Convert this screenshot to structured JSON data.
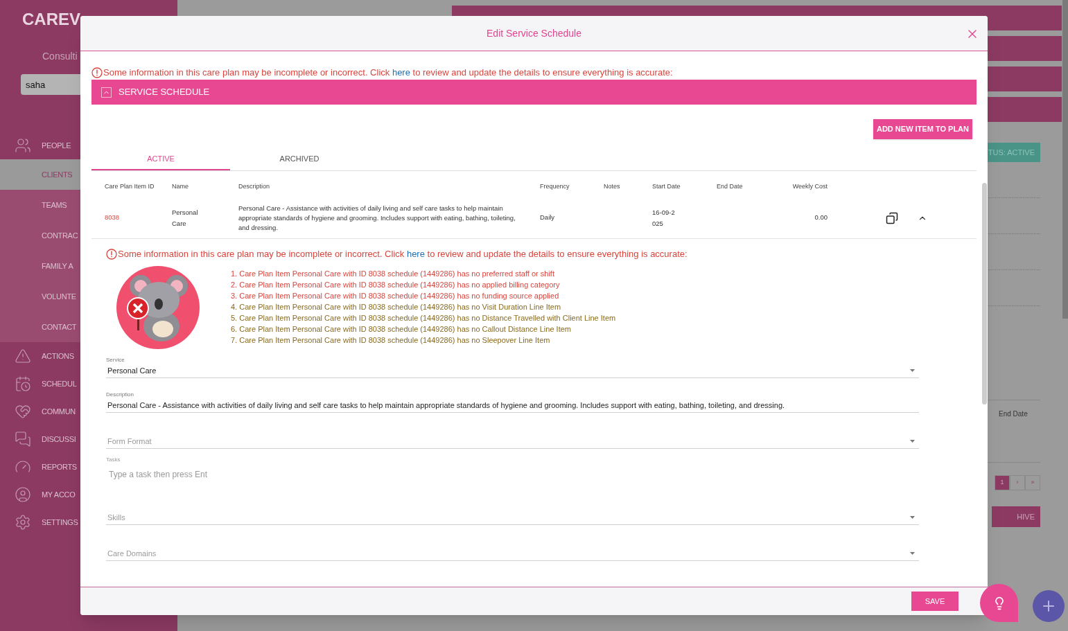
{
  "app": {
    "logo": "CAREV",
    "subtitle": "Consulti",
    "search": {
      "value": "saha"
    }
  },
  "sidebar": {
    "items": [
      {
        "label": "PEOPLE",
        "kind": "section",
        "selected": false
      },
      {
        "label": "CLIENTS",
        "kind": "sub",
        "selected": true
      },
      {
        "label": "TEAMS",
        "kind": "sub",
        "selected": false
      },
      {
        "label": "CONTRAC",
        "kind": "sub",
        "selected": false
      },
      {
        "label": "FAMILY A",
        "kind": "sub",
        "selected": false
      },
      {
        "label": "VOLUNTE",
        "kind": "sub",
        "selected": false
      },
      {
        "label": "CONTACT",
        "kind": "sub",
        "selected": false
      },
      {
        "label": "ACTIONS",
        "kind": "section",
        "selected": false
      },
      {
        "label": "SCHEDUL",
        "kind": "section",
        "selected": false
      },
      {
        "label": "COMMUN",
        "kind": "section",
        "selected": false
      },
      {
        "label": "DISCUSSI",
        "kind": "section",
        "selected": false
      },
      {
        "label": "REPORTS",
        "kind": "section",
        "selected": false
      },
      {
        "label": "MY ACCO",
        "kind": "section",
        "selected": false
      },
      {
        "label": "SETTINGS",
        "kind": "section",
        "selected": false
      }
    ]
  },
  "background": {
    "status_button": "TUS: ACTIVE",
    "column_header": "End Date",
    "pagination": [
      {
        "label": "1",
        "selected": true
      },
      {
        "label": "›",
        "selected": false
      },
      {
        "label": "»",
        "selected": false
      }
    ],
    "archive_button": "HIVE"
  },
  "modal": {
    "title": "Edit Service Schedule",
    "warning": {
      "before": "Some information in this care plan may be incomplete or incorrect. Click ",
      "link": "here",
      "after": " to review and update the details to ensure everything is accurate:"
    },
    "section": {
      "title": "SERVICE SCHEDULE",
      "expanded": true
    },
    "add_button": "ADD NEW ITEM TO PLAN",
    "tabs": [
      {
        "label": "ACTIVE",
        "selected": true
      },
      {
        "label": "ARCHIVED",
        "selected": false
      }
    ],
    "table": {
      "columns": [
        "Care Plan Item ID",
        "Name",
        "Description",
        "Frequency",
        "Notes",
        "Start Date",
        "End Date",
        "Weekly Cost"
      ],
      "rows": [
        {
          "id": "8038",
          "name": "Personal Care",
          "description": "Personal Care - Assistance with activities of daily living and self care tasks to help maintain appropriate standards of hygiene and grooming. Includes support with eating, bathing, toileting, and dressing.",
          "frequency": "Daily",
          "start_date": "16-09-2025",
          "weekly_cost": "0.00",
          "expanded": true
        }
      ]
    },
    "row_warning": {
      "before": "Some information in this care plan may be incomplete or incorrect. Click ",
      "link": "here",
      "after": " to review and update the details to ensure everything is accurate:"
    },
    "issues": [
      {
        "text": "1. Care Plan Item Personal Care with ID 8038 schedule (1449286) has no preferred staff or shift",
        "color": "#d9443c"
      },
      {
        "text": "2. Care Plan Item Personal Care with ID 8038 schedule (1449286) has no applied billing category",
        "color": "#d9443c"
      },
      {
        "text": "3. Care Plan Item Personal Care with ID 8038 schedule (1449286) has no funding source applied",
        "color": "#d9443c"
      },
      {
        "text": "4. Care Plan Item Personal Care with ID 8038 schedule (1449286) has no Visit Duration Line Item",
        "color": "#8a6a1e"
      },
      {
        "text": "5. Care Plan Item Personal Care with ID 8038 schedule (1449286) has no Distance Travelled with Client Line Item",
        "color": "#8a6a1e"
      },
      {
        "text": "6. Care Plan Item Personal Care with ID 8038 schedule (1449286) has no Callout Distance Line Item",
        "color": "#8a6a1e"
      },
      {
        "text": "7. Care Plan Item Personal Care with ID 8038 schedule (1449286) has no Sleepover Line Item",
        "color": "#8a6a1e"
      }
    ],
    "fields": [
      {
        "kind": "select",
        "label": "Service",
        "value": "Personal Care"
      },
      {
        "kind": "text",
        "label": "Description",
        "value": "Personal Care - Assistance with activities of daily living and self care tasks to help maintain appropriate standards of hygiene and grooming. Includes support with eating, bathing, toileting, and dressing."
      },
      {
        "kind": "select",
        "placeholder": "Form Format"
      },
      {
        "kind": "tasks",
        "label": "Tasks",
        "placeholder": "Type a task then press Ent"
      },
      {
        "kind": "select",
        "placeholder": "Skills"
      },
      {
        "kind": "select",
        "placeholder": "Care Domains"
      }
    ],
    "save_button": "SAVE"
  }
}
